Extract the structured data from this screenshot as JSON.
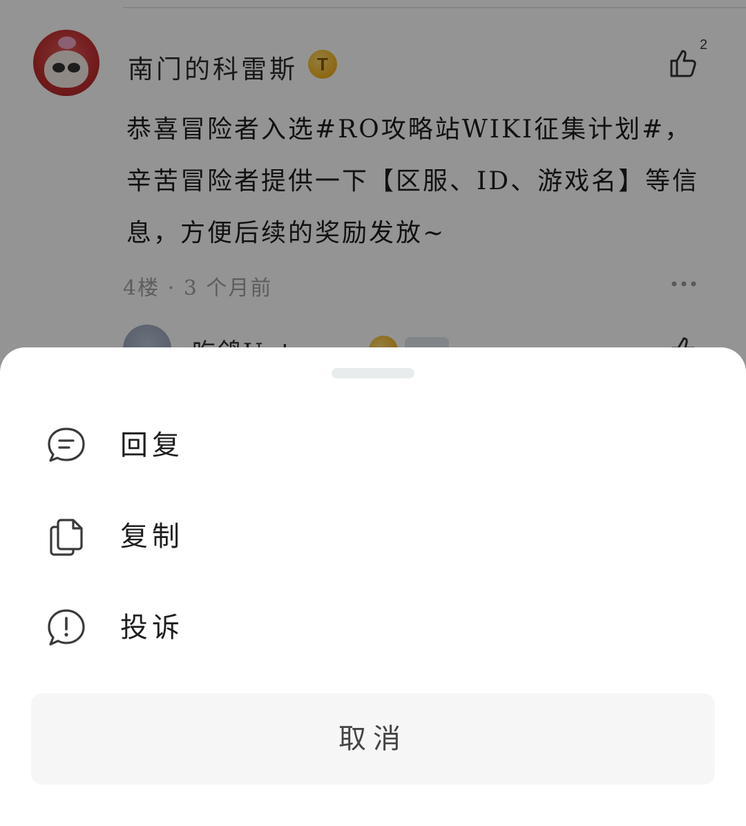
{
  "comment": {
    "username": "南门的科雷斯",
    "badge_text": "T",
    "like_count": "2",
    "text": "恭喜冒险者入选#RO攻略站WIKI征集计划#，辛苦冒险者提供一下【区服、ID、游戏名】等信息，方便后续的奖励发放~",
    "meta": "4楼 · 3 个月前"
  },
  "reply_preview": {
    "username": "吃鸽Uotaro"
  },
  "sheet": {
    "items": [
      {
        "label": "回复",
        "icon": "message-icon"
      },
      {
        "label": "复制",
        "icon": "copy-icon"
      },
      {
        "label": "投诉",
        "icon": "warning-icon"
      }
    ],
    "cancel_label": "取消"
  },
  "colors": {
    "overlay": "rgba(0,0,0,0.42)",
    "sheet_bg": "#ffffff",
    "cancel_bg": "#f6f6f6",
    "handle": "#e8ecec"
  }
}
